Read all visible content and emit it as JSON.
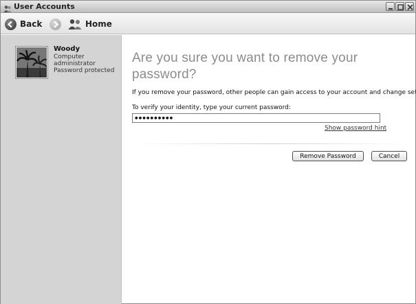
{
  "window": {
    "title": "User Accounts",
    "controls": [
      "minimize",
      "maximize",
      "close"
    ]
  },
  "toolbar": {
    "back_label": "Back",
    "home_label": "Home"
  },
  "user": {
    "name": "Woody",
    "role_line1": "Computer",
    "role_line2": "administrator",
    "status": "Password protected"
  },
  "main": {
    "heading": "Are you sure you want to remove your password?",
    "info": "If you remove your password, other people can gain access to your account and change settings.",
    "prompt": "To verify your identity, type your current password:",
    "password_value": "••••••••••",
    "hint_link": "Show password hint"
  },
  "buttons": {
    "remove_label": "Remove Password",
    "cancel_label": "Cancel"
  },
  "colors": {
    "left_pane_bg": "#d4d4d4",
    "heading": "#8c8c8c",
    "titlebar": "#bdbdbd"
  }
}
